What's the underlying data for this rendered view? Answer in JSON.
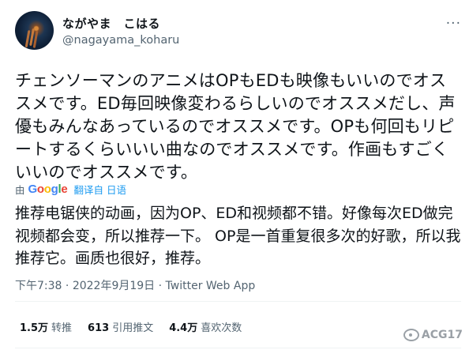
{
  "user": {
    "display_name": "ながやま　こはる",
    "handle": "@nagayama_koharu"
  },
  "tweet": {
    "text": "チェンソーマンのアニメはOPもEDも映像もいいのでオススメです。ED毎回映像変わるらしいのでオススメだし、声優もみんなあっているのでオススメです。OPも何回もリピートするくらいいい曲なのでオススメです。作画もすごくいいのでオススメです。",
    "translated_text": "推荐电锯侠的动画，因为OP、ED和视频都不错。好像每次ED做完视频都会变，所以推荐一下。 OP是一首重复很多次的好歌，所以我推荐它。画质也很好，推荐。"
  },
  "translation": {
    "prefix": "由",
    "google_letters": [
      "G",
      "o",
      "o",
      "g",
      "l",
      "e"
    ],
    "action_label": "翻译自",
    "language": "日语"
  },
  "meta": {
    "time": "下午7:38",
    "separator": " · ",
    "date": "2022年9月19日",
    "source": "Twitter Web App"
  },
  "stats": [
    {
      "count": "1.5万",
      "label": "转推"
    },
    {
      "count": "613",
      "label": "引用推文"
    },
    {
      "count": "4.4万",
      "label": "喜欢次数"
    }
  ],
  "more_icon": "···",
  "watermark": {
    "text": "ACG17"
  },
  "colors": {
    "text": "#0f1419",
    "secondary": "#536471",
    "link": "#1d9bf0",
    "divider": "#eff3f4"
  }
}
